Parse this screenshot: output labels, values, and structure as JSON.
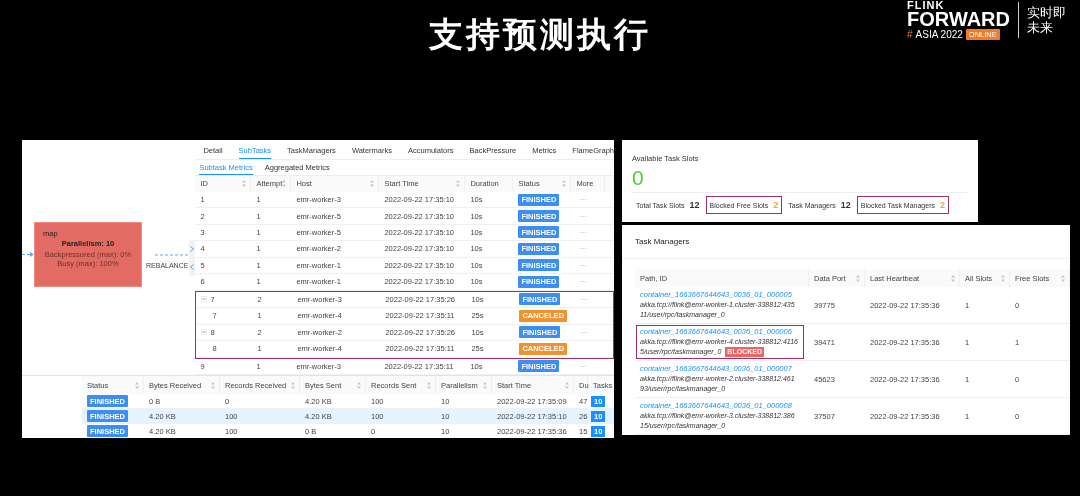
{
  "slide": {
    "title": "支持预测执行"
  },
  "logo": {
    "line_1": "FLINK",
    "line_2": "FORWARD",
    "hash": "#",
    "event": "ASIA 2022",
    "badge": "ONLINE",
    "slogan_1": "实时即",
    "slogan_2": "未来"
  },
  "job_view": {
    "graph": {
      "node": {
        "name": "map",
        "parallelism": "Parallelism: 10",
        "backpressured": "Backpressured (max): 0%",
        "busy": "Busy (max): 100%"
      },
      "edge_label": "REBALANCE"
    },
    "tabs": [
      {
        "label": "Detail",
        "selected": false
      },
      {
        "label": "SubTasks",
        "selected": true
      },
      {
        "label": "TaskManagers",
        "selected": false
      },
      {
        "label": "Watermarks",
        "selected": false
      },
      {
        "label": "Accumulators",
        "selected": false
      },
      {
        "label": "BackPressure",
        "selected": false
      },
      {
        "label": "Metrics",
        "selected": false
      },
      {
        "label": "FlameGraph",
        "selected": false
      }
    ],
    "subtabs": [
      {
        "label": "Subtask Metrics",
        "selected": true
      },
      {
        "label": "Aggregated Metrics",
        "selected": false
      }
    ],
    "subtasks": {
      "columns": [
        {
          "label": "ID",
          "sortable": true
        },
        {
          "label": "Attempt",
          "sortable": true
        },
        {
          "label": "Host",
          "sortable": true
        },
        {
          "label": "Start Time",
          "sortable": true
        },
        {
          "label": "Duration",
          "sortable": false
        },
        {
          "label": "Status",
          "sortable": true
        },
        {
          "label": "More",
          "sortable": false
        }
      ],
      "rows": [
        {
          "id": "1",
          "attempt": "1",
          "host": "emr-worker-3",
          "start": "2022-09-22 17:35:10",
          "duration": "10s",
          "status": "FINISHED",
          "color": "#3d8ef2",
          "more": "···",
          "highlighted": false
        },
        {
          "id": "2",
          "attempt": "1",
          "host": "emr-worker-5",
          "start": "2022-09-22 17:35:10",
          "duration": "10s",
          "status": "FINISHED",
          "color": "#3d8ef2",
          "more": "···",
          "highlighted": false
        },
        {
          "id": "3",
          "attempt": "1",
          "host": "emr-worker-5",
          "start": "2022-09-22 17:35:10",
          "duration": "10s",
          "status": "FINISHED",
          "color": "#3d8ef2",
          "more": "···",
          "highlighted": false
        },
        {
          "id": "4",
          "attempt": "1",
          "host": "emr-worker-2",
          "start": "2022-09-22 17:35:10",
          "duration": "10s",
          "status": "FINISHED",
          "color": "#3d8ef2",
          "more": "···",
          "highlighted": false
        },
        {
          "id": "5",
          "attempt": "1",
          "host": "emr-worker-1",
          "start": "2022-09-22 17:35:10",
          "duration": "10s",
          "status": "FINISHED",
          "color": "#3d8ef2",
          "more": "···",
          "highlighted": false
        },
        {
          "id": "6",
          "attempt": "1",
          "host": "emr-worker-1",
          "start": "2022-09-22 17:35:10",
          "duration": "10s",
          "status": "FINISHED",
          "color": "#3d8ef2",
          "more": "···",
          "highlighted": false
        },
        {
          "id": "7",
          "attempt": "2",
          "host": "emr-worker-3",
          "start": "2022-09-22 17:35:26",
          "duration": "10s",
          "status": "FINISHED",
          "color": "#3d8ef2",
          "more": "···",
          "highlighted": true,
          "expanded": true,
          "children": [
            {
              "id": "7",
              "attempt": "1",
              "host": "emr-worker-4",
              "start": "2022-09-22 17:35:11",
              "duration": "25s",
              "status": "CANCELED",
              "color": "#f0922e"
            }
          ]
        },
        {
          "id": "8",
          "attempt": "2",
          "host": "emr-worker-2",
          "start": "2022-09-22 17:35:26",
          "duration": "10s",
          "status": "FINISHED",
          "color": "#3d8ef2",
          "more": "···",
          "highlighted": true,
          "expanded": true,
          "children": [
            {
              "id": "8",
              "attempt": "1",
              "host": "emr-worker-4",
              "start": "2022-09-22 17:35:11",
              "duration": "25s",
              "status": "CANCELED",
              "color": "#f0922e"
            }
          ]
        },
        {
          "id": "9",
          "attempt": "1",
          "host": "emr-worker-3",
          "start": "2022-09-22 17:35:11",
          "duration": "10s",
          "status": "FINISHED",
          "color": "#3d8ef2",
          "more": "···",
          "highlighted": false
        }
      ]
    },
    "vertices": {
      "columns": [
        {
          "label": "Status",
          "sortable": true
        },
        {
          "label": "Bytes Received",
          "sortable": true
        },
        {
          "label": "Records Received",
          "sortable": true
        },
        {
          "label": "Bytes Sent",
          "sortable": true
        },
        {
          "label": "Records Sent",
          "sortable": true
        },
        {
          "label": "Parallelism",
          "sortable": true
        },
        {
          "label": "Start Time",
          "sortable": true
        },
        {
          "label": "Du"
        },
        {
          "label": "Tasks",
          "sortable": false
        }
      ],
      "rows": [
        {
          "color": "#3d8ef2",
          "cells": [
            "FINISHED",
            "0 B",
            "0",
            "4.20 KB",
            "100",
            "10",
            "2022-09-22 17:35:09",
            "47",
            "10"
          ],
          "selected": false
        },
        {
          "color": "#3d8ef2",
          "cells": [
            "FINISHED",
            "4.20 KB",
            "100",
            "4.20 KB",
            "100",
            "10",
            "2022-09-22 17:35:10",
            "26",
            "10"
          ],
          "selected": true
        },
        {
          "color": "#3d8ef2",
          "cells": [
            "FINISHED",
            "4.20 KB",
            "100",
            "0 B",
            "0",
            "10",
            "2022-09-22 17:35:36",
            "15",
            "10"
          ],
          "selected": false
        }
      ]
    }
  },
  "slots": {
    "title": "Available Task Slots",
    "value": "0",
    "stats": [
      {
        "label": "Total Task Slots",
        "value": "12",
        "highlighted": false,
        "color": "#333333"
      },
      {
        "label": "Blocked Free Slots",
        "value": "2",
        "highlighted": true,
        "color": "#f5a623"
      },
      {
        "label": "Task Managers",
        "value": "12",
        "highlighted": false,
        "color": "#333333"
      },
      {
        "label": "Blocked Task Managers",
        "value": "2",
        "highlighted": true,
        "color": "#f5a623"
      }
    ]
  },
  "task_managers": {
    "title": "Task Managers",
    "columns": [
      {
        "label": "Path, ID",
        "sortable": false
      },
      {
        "label": "Data Port",
        "sortable": true
      },
      {
        "label": "Last Heartbeat",
        "sortable": true
      },
      {
        "label": "All Slots",
        "sortable": true
      },
      {
        "label": "Free Slots",
        "sortable": true
      }
    ],
    "rows": [
      {
        "container": "container_1663667644643_0036_01_000005",
        "path": "akka.tcp://flink@emr-worker-1.cluster-338812:43511/user/rpc/taskmanager_0",
        "highlighted": false,
        "data_port": "39775",
        "heartbeat": "2022-09-22 17:35:36",
        "all_slots": "1",
        "free_slots": "0"
      },
      {
        "container": "container_1663667644643_0036_01_000006",
        "path": "akka.tcp://flink@emr-worker-4.cluster-338812:41165/user/rpc/taskmanager_0",
        "badge": "BLOCKED",
        "highlighted": true,
        "data_port": "39471",
        "heartbeat": "2022-09-22 17:35:36",
        "all_slots": "1",
        "free_slots": "1"
      },
      {
        "container": "container_1663667644643_0036_01_000007",
        "path": "akka.tcp://flink@emr-worker-2.cluster-338812:46193/user/rpc/taskmanager_0",
        "highlighted": false,
        "data_port": "45623",
        "heartbeat": "2022-09-22 17:35:36",
        "all_slots": "1",
        "free_slots": "0"
      },
      {
        "container": "container_1663667644643_0036_01_000008",
        "path": "akka.tcp://flink@emr-worker-3.cluster-338812:38615/user/rpc/taskmanager_0",
        "highlighted": false,
        "data_port": "37507",
        "heartbeat": "2022-09-22 17:35:36",
        "all_slots": "1",
        "free_slots": "0"
      }
    ]
  }
}
